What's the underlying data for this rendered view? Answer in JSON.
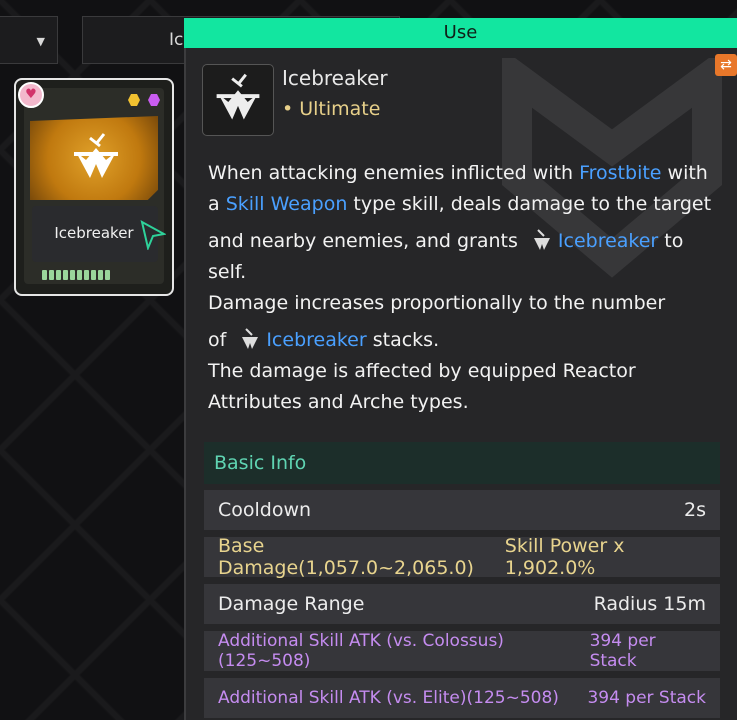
{
  "header": {
    "search_value": "Ic"
  },
  "card": {
    "name": "Icebreaker",
    "favorite_icon": "heart-icon"
  },
  "tooltip": {
    "use_label": "Use",
    "title": "Icebreaker",
    "type": "• Ultimate",
    "description": {
      "l1_a": "When attacking enemies inflicted with ",
      "l1_kw": "Frostbite",
      "l1_b": " with",
      "l2_a": "a ",
      "l2_kw": "Skill Weapon",
      "l2_b": " type skill, deals damage to the target",
      "l3_a": "and nearby enemies, and grants",
      "l3_kw": "Icebreaker",
      "l3_b": " to",
      "l4": "self.",
      "l5": "Damage increases proportionally to the number",
      "l6_a": "of",
      "l6_kw": "Icebreaker",
      "l6_b": " stacks.",
      "l7": "The damage is affected by equipped Reactor",
      "l8": "Attributes and Arche types."
    },
    "basic_info_label": "Basic Info",
    "rows": [
      {
        "label": "Cooldown",
        "value": "2s"
      },
      {
        "label": "Base Damage(1,057.0~2,065.0)",
        "value": "Skill Power x 1,902.0%"
      },
      {
        "label": "Damage Range",
        "value": "Radius 15m"
      },
      {
        "label": "Additional Skill ATK (vs. Colossus)(125~508)",
        "value": "394 per Stack"
      },
      {
        "label": "Additional Skill ATK (vs. Elite)(125~508)",
        "value": "394 per Stack"
      }
    ]
  },
  "colors": {
    "use_bar": "#12e6a0",
    "keyword": "#4aa0ff",
    "section_header": "#5fd4b2",
    "yellow_stat": "#e8d48e",
    "purple_stat": "#c58cf0"
  }
}
